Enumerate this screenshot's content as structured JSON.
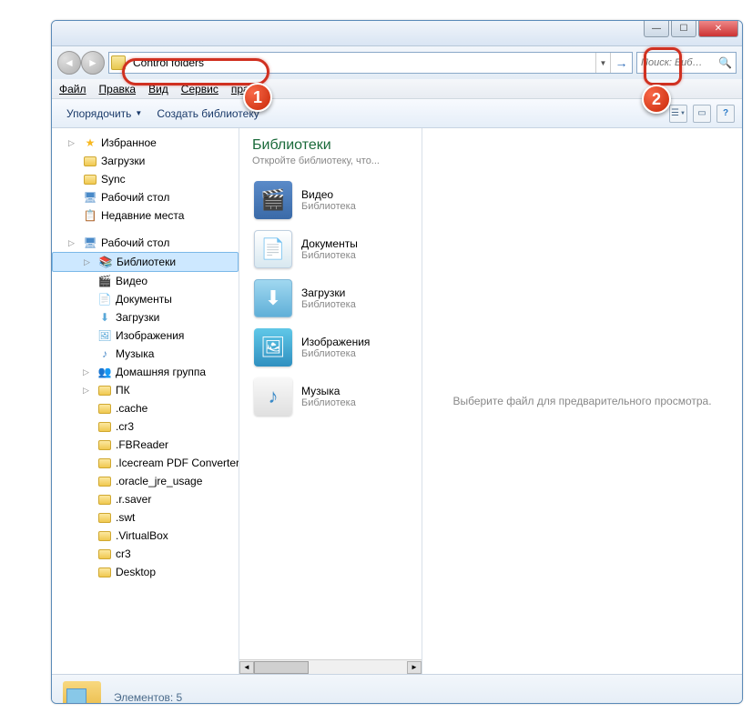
{
  "titlebar": {
    "min": "—",
    "max": "☐",
    "close": "✕"
  },
  "nav": {
    "back": "◄",
    "forward": "►",
    "address_value": "Control folders",
    "dropdown": "▼",
    "go": "→",
    "search_placeholder": "Поиск: Биб…",
    "search_icon": "🔍"
  },
  "menu": {
    "file": "Файл",
    "edit": "Правка",
    "view": "Вид",
    "service": "Сервис",
    "help": "правка"
  },
  "toolbar": {
    "organize": "Упорядочить",
    "dd": "▼",
    "create_lib": "Создать библиотеку",
    "view_icon": "☰",
    "preview_icon": "▭",
    "help_icon": "?"
  },
  "sidebar": {
    "favorites": "Избранное",
    "fav_items": [
      "Загрузки",
      "Sync",
      "Рабочий стол",
      "Недавние места"
    ],
    "desktop": "Рабочий стол",
    "libraries": "Библиотеки",
    "lib_items": [
      "Видео",
      "Документы",
      "Загрузки",
      "Изображения",
      "Музыка"
    ],
    "homegroup": "Домашняя группа",
    "pc": "ПК",
    "pc_items": [
      ".cache",
      ".cr3",
      ".FBReader",
      ".Icecream PDF Converter",
      ".oracle_jre_usage",
      ".r.saver",
      ".swt",
      ".VirtualBox",
      "cr3",
      "Desktop"
    ]
  },
  "content": {
    "title": "Библиотеки",
    "subtitle": "Откройте библиотеку, что...",
    "items": [
      {
        "name": "Видео",
        "type": "Библиотека"
      },
      {
        "name": "Документы",
        "type": "Библиотека"
      },
      {
        "name": "Загрузки",
        "type": "Библиотека"
      },
      {
        "name": "Изображения",
        "type": "Библиотека"
      },
      {
        "name": "Музыка",
        "type": "Библиотека"
      }
    ]
  },
  "preview": {
    "text": "Выберите файл для предварительного просмотра."
  },
  "status": {
    "text": "Элементов: 5"
  },
  "badges": {
    "b1": "1",
    "b2": "2"
  }
}
